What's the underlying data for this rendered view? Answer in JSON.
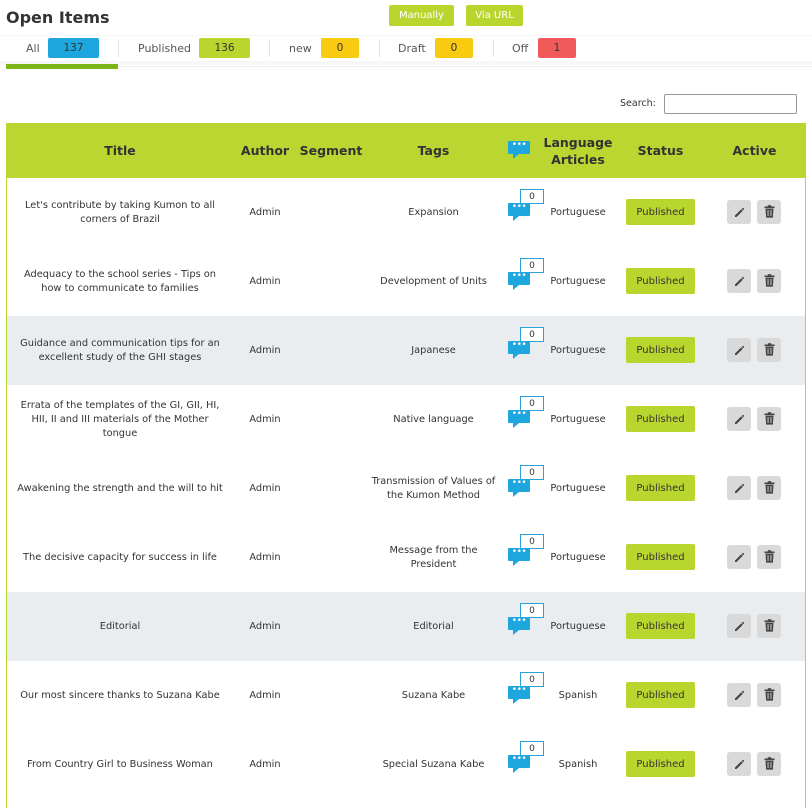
{
  "page": {
    "title": "Open Items"
  },
  "actions": {
    "manually_label": "Manually",
    "via_url_label": "Via URL"
  },
  "filters": [
    {
      "label": "All",
      "count": "137",
      "color": "#1ea6df"
    },
    {
      "label": "Published",
      "count": "136",
      "color": "#b9d62f"
    },
    {
      "label": "new",
      "count": "0",
      "color": "#f8cb10"
    },
    {
      "label": "Draft",
      "count": "0",
      "color": "#f8cb10"
    },
    {
      "label": "Off",
      "count": "1",
      "color": "#f05a5a"
    }
  ],
  "search": {
    "label": "Search:",
    "value": ""
  },
  "table": {
    "headers": {
      "title": "Title",
      "author": "Author",
      "segment": "Segment",
      "tags": "Tags",
      "comments_icon": "comment-icon",
      "language_line1": "Language",
      "language_line2": "Articles",
      "status": "Status",
      "active": "Active"
    },
    "rows": [
      {
        "title": "Let's contribute by taking Kumon to all corners of Brazil",
        "author": "Admin",
        "segment": "",
        "tags": "Expansion",
        "comments": "0",
        "language": "Portuguese",
        "status": "Published"
      },
      {
        "title": "Adequacy to the school series - Tips on how to communicate to families",
        "author": "Admin",
        "segment": "",
        "tags": "Development of Units",
        "comments": "0",
        "language": "Portuguese",
        "status": "Published"
      },
      {
        "title": "Guidance and communication tips for an excellent study of the GHI stages",
        "author": "Admin",
        "segment": "",
        "tags": "Japanese",
        "comments": "0",
        "language": "Portuguese",
        "status": "Published"
      },
      {
        "title": "Errata of the templates of the GI, GII, HI, HII, II and III materials of the Mother tongue",
        "author": "Admin",
        "segment": "",
        "tags": "Native language",
        "comments": "0",
        "language": "Portuguese",
        "status": "Published"
      },
      {
        "title": "Awakening the strength and the will to hit",
        "author": "Admin",
        "segment": "",
        "tags": "Transmission of Values of the Kumon Method",
        "comments": "0",
        "language": "Portuguese",
        "status": "Published"
      },
      {
        "title": "The decisive capacity for success in life",
        "author": "Admin",
        "segment": "",
        "tags": "Message from the President",
        "comments": "0",
        "language": "Portuguese",
        "status": "Published"
      },
      {
        "title": "Editorial",
        "author": "Admin",
        "segment": "",
        "tags": "Editorial",
        "comments": "0",
        "language": "Portuguese",
        "status": "Published"
      },
      {
        "title": "Our most sincere thanks to Suzana Kabe",
        "author": "Admin",
        "segment": "",
        "tags": "Suzana Kabe",
        "comments": "0",
        "language": "Spanish",
        "status": "Published"
      },
      {
        "title": "From Country Girl to Business Woman",
        "author": "Admin",
        "segment": "",
        "tags": "Special Suzana Kabe",
        "comments": "0",
        "language": "Spanish",
        "status": "Published"
      }
    ],
    "row_icons": {
      "edit": "pencil-icon",
      "delete": "trash-icon"
    }
  },
  "colors": {
    "accent_green": "#bcd631",
    "comment_blue": "#1ea6df",
    "alt_row": "#eaedf0"
  }
}
